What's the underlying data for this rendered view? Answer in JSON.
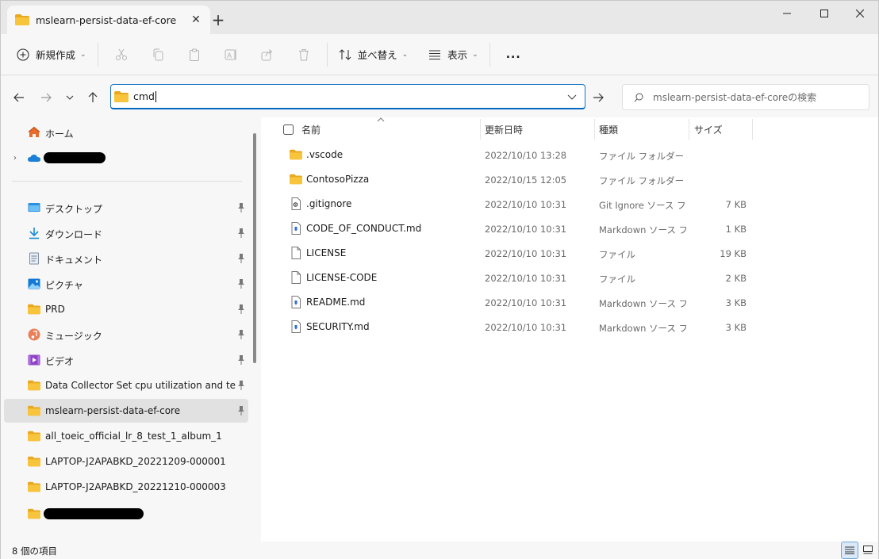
{
  "window": {
    "tab_title": "mslearn-persist-data-ef-core",
    "colors": {
      "accent": "#0067c0",
      "folder": "#f8c43c",
      "folder_dark": "#e8a920"
    }
  },
  "toolbar": {
    "new_label": "新規作成",
    "sort_label": "並べ替え",
    "view_label": "表示",
    "more_label": "..."
  },
  "address": {
    "value": "cmd",
    "search_placeholder": "mslearn-persist-data-ef-coreの検索"
  },
  "sidebar": {
    "home_label": "ホーム",
    "items": [
      {
        "label": "デスクトップ",
        "icon": "desktop-icon",
        "pinned": true
      },
      {
        "label": "ダウンロード",
        "icon": "download-icon",
        "pinned": true
      },
      {
        "label": "ドキュメント",
        "icon": "document-icon",
        "pinned": true
      },
      {
        "label": "ピクチャ",
        "icon": "picture-icon",
        "pinned": true
      },
      {
        "label": "PRD",
        "icon": "folder-icon",
        "pinned": true
      },
      {
        "label": "ミュージック",
        "icon": "music-icon",
        "pinned": true
      },
      {
        "label": "ビデオ",
        "icon": "video-icon",
        "pinned": true
      },
      {
        "label": "Data Collector Set cpu utilization and tempert",
        "icon": "folder-icon",
        "pinned": true
      },
      {
        "label": "mslearn-persist-data-ef-core",
        "icon": "folder-icon",
        "pinned": true,
        "selected": true
      },
      {
        "label": "all_toeic_official_lr_8_test_1_album_1",
        "icon": "folder-icon",
        "pinned": false
      },
      {
        "label": "LAPTOP-J2APABKD_20221209-000001",
        "icon": "folder-icon",
        "pinned": false
      },
      {
        "label": "LAPTOP-J2APABKD_20221210-000003",
        "icon": "folder-icon",
        "pinned": false
      }
    ]
  },
  "columns": {
    "name": "名前",
    "date": "更新日時",
    "type": "種類",
    "size": "サイズ"
  },
  "files": [
    {
      "name": ".vscode",
      "date": "2022/10/10 13:28",
      "type": "ファイル フォルダー",
      "size": "",
      "icon": "folder-icon"
    },
    {
      "name": "ContosoPizza",
      "date": "2022/10/15 12:05",
      "type": "ファイル フォルダー",
      "size": "",
      "icon": "folder-icon"
    },
    {
      "name": ".gitignore",
      "date": "2022/10/10 10:31",
      "type": "Git Ignore ソース フ...",
      "size": "7 KB",
      "icon": "config-file-icon"
    },
    {
      "name": "CODE_OF_CONDUCT.md",
      "date": "2022/10/10 10:31",
      "type": "Markdown ソース フ...",
      "size": "1 KB",
      "icon": "markdown-file-icon"
    },
    {
      "name": "LICENSE",
      "date": "2022/10/10 10:31",
      "type": "ファイル",
      "size": "19 KB",
      "icon": "file-icon"
    },
    {
      "name": "LICENSE-CODE",
      "date": "2022/10/10 10:31",
      "type": "ファイル",
      "size": "2 KB",
      "icon": "file-icon"
    },
    {
      "name": "README.md",
      "date": "2022/10/10 10:31",
      "type": "Markdown ソース フ...",
      "size": "3 KB",
      "icon": "markdown-file-icon"
    },
    {
      "name": "SECURITY.md",
      "date": "2022/10/10 10:31",
      "type": "Markdown ソース フ...",
      "size": "3 KB",
      "icon": "markdown-file-icon"
    }
  ],
  "status": {
    "item_count": "8 個の項目"
  }
}
